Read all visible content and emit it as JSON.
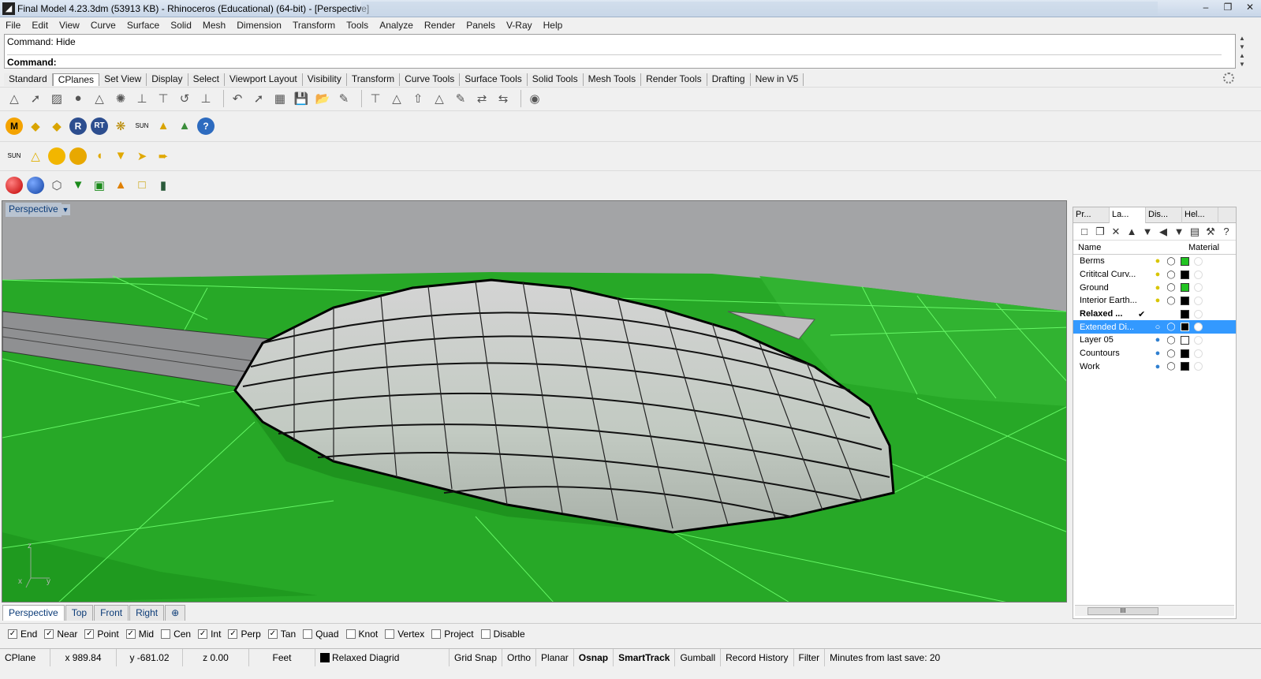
{
  "window": {
    "title": "Final Model 4.23.3dm (53913 KB) - Rhinoceros (Educational) (64-bit) - [Perspective]",
    "minimize": "–",
    "restore": "❐",
    "close": "✕"
  },
  "menu": [
    "File",
    "Edit",
    "View",
    "Curve",
    "Surface",
    "Solid",
    "Mesh",
    "Dimension",
    "Transform",
    "Tools",
    "Analyze",
    "Render",
    "Panels",
    "V-Ray",
    "Help"
  ],
  "command": {
    "history": "Command: Hide",
    "prompt": "Command:"
  },
  "toolbar_tabs": [
    "Standard",
    "CPlanes",
    "Set View",
    "Display",
    "Select",
    "Viewport Layout",
    "Visibility",
    "Transform",
    "Curve Tools",
    "Surface Tools",
    "Solid Tools",
    "Mesh Tools",
    "Render Tools",
    "Drafting",
    "New in V5"
  ],
  "active_tab": "CPlanes",
  "vray_icons": {
    "row1": [
      "M",
      "R",
      "RT",
      "?"
    ],
    "sun_label": "SUN"
  },
  "viewport": {
    "label": "Perspective",
    "axis_x": "x",
    "axis_y": "y",
    "axis_z": "z"
  },
  "viewport_tabs": [
    "Perspective",
    "Top",
    "Front",
    "Right"
  ],
  "add_viewport": "⊕",
  "panel": {
    "tabs": [
      "Pr...",
      "La...",
      "Dis...",
      "Hel..."
    ],
    "header_name": "Name",
    "header_material": "Material",
    "scroll_glyph": "III",
    "layers": [
      {
        "name": "Berms",
        "color": "#22c422",
        "current": false,
        "selected": false,
        "bold": false
      },
      {
        "name": "Crititcal Curv...",
        "color": "#000000",
        "current": false,
        "selected": false,
        "bold": false
      },
      {
        "name": "Ground",
        "color": "#22c422",
        "current": false,
        "selected": false,
        "bold": false
      },
      {
        "name": "Interior Earth...",
        "color": "#000000",
        "current": false,
        "selected": false,
        "bold": false
      },
      {
        "name": "Relaxed ...",
        "color": "#000000",
        "current": true,
        "selected": false,
        "bold": true
      },
      {
        "name": "Extended Di...",
        "color": "#000000",
        "current": false,
        "selected": true,
        "bold": false
      },
      {
        "name": "Layer 05",
        "color": "#ffffff",
        "current": false,
        "selected": false,
        "bold": false
      },
      {
        "name": "Countours",
        "color": "#000000",
        "current": false,
        "selected": false,
        "bold": false
      },
      {
        "name": "Work",
        "color": "#000000",
        "current": false,
        "selected": false,
        "bold": false
      }
    ],
    "check_glyph": "✔"
  },
  "osnaps": [
    {
      "label": "End",
      "checked": true
    },
    {
      "label": "Near",
      "checked": true
    },
    {
      "label": "Point",
      "checked": true
    },
    {
      "label": "Mid",
      "checked": true
    },
    {
      "label": "Cen",
      "checked": false
    },
    {
      "label": "Int",
      "checked": true
    },
    {
      "label": "Perp",
      "checked": true
    },
    {
      "label": "Tan",
      "checked": true
    },
    {
      "label": "Quad",
      "checked": false
    },
    {
      "label": "Knot",
      "checked": false
    },
    {
      "label": "Vertex",
      "checked": false
    },
    {
      "label": "Project",
      "checked": false
    },
    {
      "label": "Disable",
      "checked": false
    }
  ],
  "status": {
    "cplane": "CPlane",
    "x": "x 989.84",
    "y": "y -681.02",
    "z": "z 0.00",
    "units": "Feet",
    "layer": "Relaxed Diagrid",
    "grid_snap": "Grid Snap",
    "ortho": "Ortho",
    "planar": "Planar",
    "osnap": "Osnap",
    "smarttrack": "SmartTrack",
    "gumball": "Gumball",
    "record_history": "Record History",
    "filter": "Filter",
    "save": "Minutes from last save: 20"
  }
}
